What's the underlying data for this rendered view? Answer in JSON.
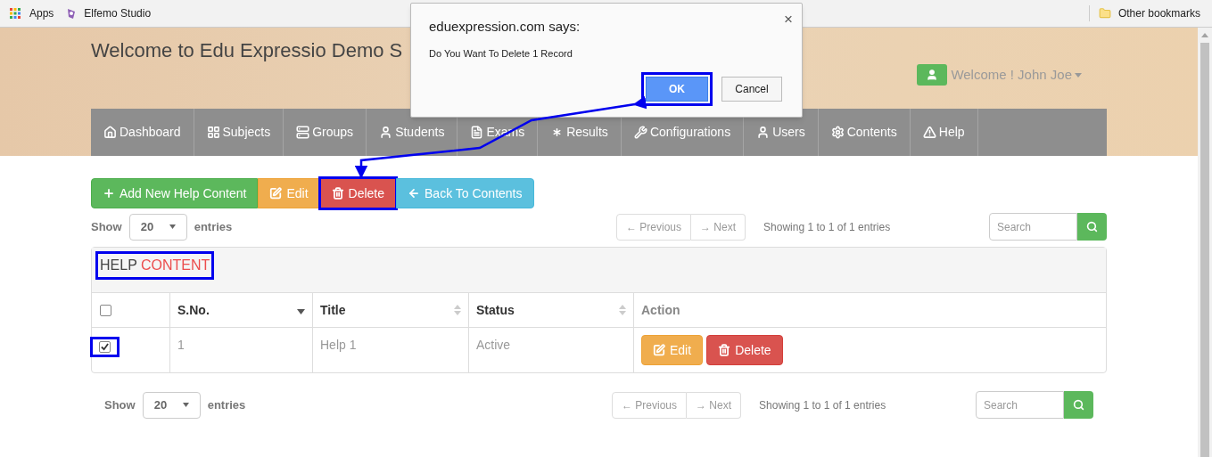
{
  "bookmarks": {
    "apps": "Apps",
    "items": [
      {
        "label": "Elfemo Studio"
      }
    ],
    "other": "Other bookmarks"
  },
  "header": {
    "title": "Welcome to Edu Expressio Demo S",
    "user": "Welcome ! John Joe"
  },
  "nav": [
    {
      "label": "Dashboard"
    },
    {
      "label": "Subjects"
    },
    {
      "label": "Groups"
    },
    {
      "label": "Students"
    },
    {
      "label": "Exams"
    },
    {
      "label": "Results"
    },
    {
      "label": "Configurations"
    },
    {
      "label": "Users"
    },
    {
      "label": "Contents"
    },
    {
      "label": "Help"
    }
  ],
  "toolbar": [
    {
      "label": "Add New Help Content",
      "kind": "add",
      "annotated": false
    },
    {
      "label": "Edit",
      "kind": "edit",
      "annotated": false
    },
    {
      "label": "Delete",
      "kind": "delete",
      "annotated": true
    },
    {
      "label": "Back To Contents",
      "kind": "back",
      "annotated": false
    }
  ],
  "top_controls": {
    "show": "Show",
    "entries_value": "20",
    "entries": "entries",
    "previous": "← Previous",
    "next": "→ Next",
    "info": "Showing 1 to 1 of 1 entries",
    "search_placeholder": "Search"
  },
  "panel": {
    "title": "HELP",
    "title_accent": "CONTENT",
    "annotated": true
  },
  "table": {
    "select_all": {
      "checked": false
    },
    "columns": [
      {
        "label": "S.No.",
        "kind": "sorted"
      },
      {
        "label": "Title",
        "kind": "sortable"
      },
      {
        "label": "Status",
        "kind": "sortable"
      },
      {
        "label": "Action",
        "kind": "plain"
      }
    ],
    "rows": [
      {
        "checked": true,
        "annotated": true,
        "sno": "1",
        "title": "Help 1",
        "status": "Active",
        "actions": [
          {
            "label": "Edit",
            "kind": "edit"
          },
          {
            "label": "Delete",
            "kind": "delete"
          }
        ]
      }
    ]
  },
  "bottom_controls": {
    "show": "Show",
    "entries_value": "20",
    "entries": "entries",
    "previous": "← Previous",
    "next": "→ Next",
    "info": "Showing 1 to 1 of 1 entries",
    "search_placeholder": "Search"
  },
  "dialog": {
    "origin": "eduexpression.com says:",
    "message": "Do You Want To Delete 1 Record",
    "close": "×",
    "buttons": [
      {
        "label": "OK",
        "primary": true,
        "annotated": true
      },
      {
        "label": "Cancel",
        "primary": false,
        "annotated": false
      }
    ]
  }
}
